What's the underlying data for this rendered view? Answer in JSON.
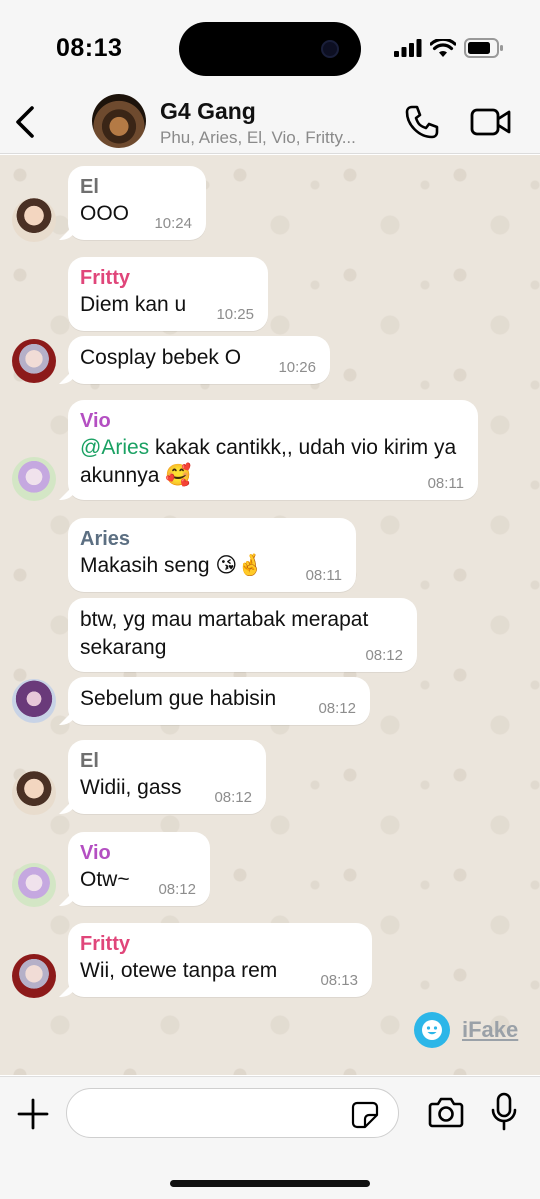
{
  "status_bar": {
    "time": "08:13"
  },
  "header": {
    "back_icon": "chevron-left-icon",
    "title": "G4 Gang",
    "subtitle": "Phu, Aries, El, Vio, Fritty..."
  },
  "messages": [
    {
      "sender": "El",
      "text": "OOO",
      "time": "10:24"
    },
    {
      "sender": "Fritty",
      "text": "Diem kan u",
      "time": "10:25"
    },
    {
      "sender": "",
      "text": "Cosplay bebek O",
      "time": "10:26"
    },
    {
      "sender": "Vio",
      "mention": "@Aries",
      "text": " kakak cantikk,, udah vio kirim ya akunnya 🥰",
      "time": "08:11"
    },
    {
      "sender": "Aries",
      "text": "Makasih seng 😘🤞",
      "time": "08:11"
    },
    {
      "sender": "",
      "text": "btw, yg mau martabak merapat sekarang",
      "time": "08:12"
    },
    {
      "sender": "",
      "text": "Sebelum gue habisin",
      "time": "08:12"
    },
    {
      "sender": "El",
      "text": "Widii, gass",
      "time": "08:12"
    },
    {
      "sender": "Vio",
      "text": "Otw~",
      "time": "08:12"
    },
    {
      "sender": "Fritty",
      "text": "Wii, otewe tanpa rem",
      "time": "08:13"
    }
  ],
  "watermark": {
    "text": "iFake"
  },
  "input": {
    "value": "",
    "placeholder": ""
  },
  "colors": {
    "chat_bg": "#ebe5dc",
    "el": "#6f6f6f",
    "fritty": "#e0467a",
    "vio": "#b44fc2",
    "aries": "#5c6f82",
    "mention": "#1aa163"
  }
}
